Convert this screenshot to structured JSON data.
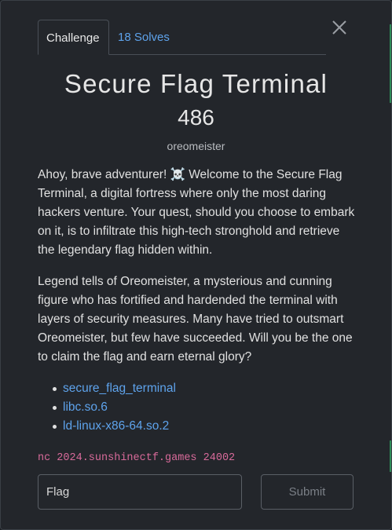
{
  "tabs": {
    "challenge_label": "Challenge",
    "solves_label": "18 Solves"
  },
  "challenge": {
    "title": "Secure Flag Terminal",
    "points": "486",
    "author": "oreomeister",
    "description_p1": "Ahoy, brave adventurer! ☠️ Welcome to the Secure Flag Terminal, a digital fortress where only the most daring hackers venture. Your quest, should you choose to embark on it, is to infiltrate this high-tech stronghold and retrieve the legendary flag hidden within.",
    "description_p2": "Legend tells of Oreomeister, a mysterious and cunning figure who has fortified and hardended the terminal with layers of security measures. Many have tried to outsmart Oreomeister, but few have succeeded. Will you be the one to claim the flag and earn eternal glory?",
    "files": [
      "secure_flag_terminal",
      "libc.so.6",
      "ld-linux-x86-64.so.2"
    ],
    "connection": "nc 2024.sunshinectf.games 24002"
  },
  "form": {
    "flag_placeholder": "Flag",
    "submit_label": "Submit"
  },
  "icons": {
    "close": "close-icon"
  },
  "colors": {
    "background": "#23262b",
    "link": "#5ea3ec",
    "connection_text": "#d86a9a",
    "accent_edge": "#2e8b57"
  }
}
